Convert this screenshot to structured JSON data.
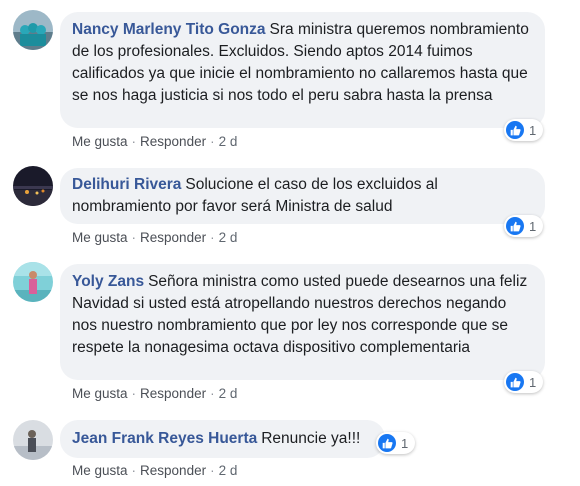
{
  "comments": [
    {
      "author": "Nancy Marleny Tito Gonza",
      "text": "Sra ministra queremos nombramiento de los profesionales. Excluidos. Siendo aptos 2014 fuimos calificados ya que inicie el nombramiento no callaremos hasta que se nos haga justicia si nos todo el peru sabra hasta la prensa",
      "like_label": "Me gusta",
      "reply_label": "Responder",
      "time": "2 d",
      "reaction_count": "1",
      "reaction_icon": "like-icon"
    },
    {
      "author": "Delihuri Rivera",
      "text": "Solucione el caso de los excluidos al nombramiento por favor será Ministra de salud",
      "like_label": "Me gusta",
      "reply_label": "Responder",
      "time": "2 d",
      "reaction_count": "1",
      "reaction_icon": "like-icon"
    },
    {
      "author": "Yoly Zans",
      "text": "Señora ministra como usted puede desearnos una feliz Navidad si usted está atropellando nuestros derechos negando nos nuestro nombramiento que por ley nos corresponde que se respete la nonagesima octava dispositivo complementaria",
      "like_label": "Me gusta",
      "reply_label": "Responder",
      "time": "2 d",
      "reaction_count": "1",
      "reaction_icon": "like-icon"
    },
    {
      "author": "Jean Frank Reyes Huerta",
      "text": "Renuncie ya!!!",
      "like_label": "Me gusta",
      "reply_label": "Responder",
      "time": "2 d",
      "reaction_count": "1",
      "reaction_icon": "like-icon"
    }
  ],
  "separator": "·",
  "colors": {
    "author": "#385898",
    "bubble": "#f0f2f5",
    "like_blue": "#1877f2",
    "meta_text": "#606770"
  }
}
